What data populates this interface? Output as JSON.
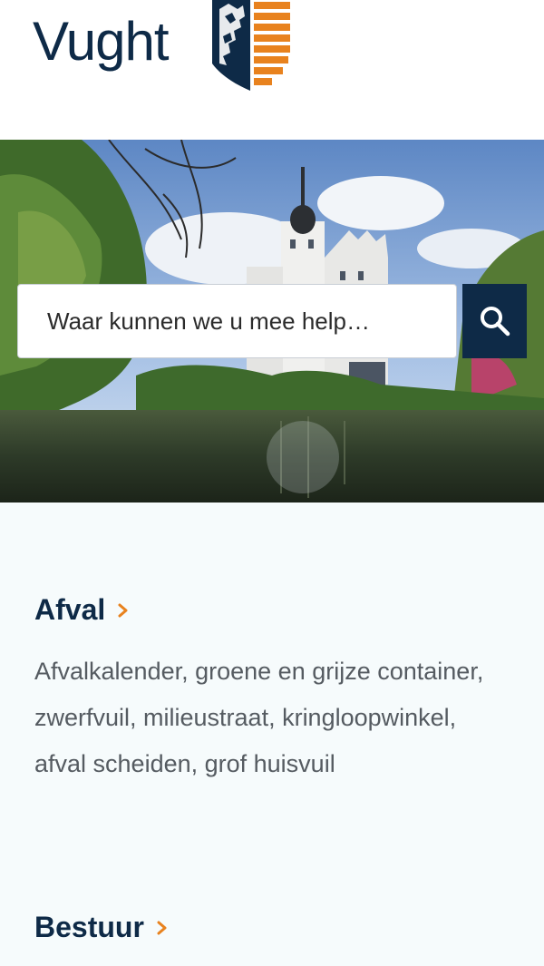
{
  "header": {
    "logo_text": "Vught"
  },
  "search": {
    "placeholder": "Waar kunnen we u mee help…"
  },
  "sections": [
    {
      "title": "Afval",
      "description": "Afvalkalender, groene en grijze container, zwerfvuil, milieustraat, kringloopwinkel, afval scheiden, grof huisvuil"
    },
    {
      "title": "Bestuur",
      "description": ""
    }
  ],
  "colors": {
    "brand_navy": "#0e2a47",
    "accent_orange": "#e8821e"
  },
  "icons": {
    "search": "search-icon",
    "chevron": "chevron-right-icon"
  }
}
